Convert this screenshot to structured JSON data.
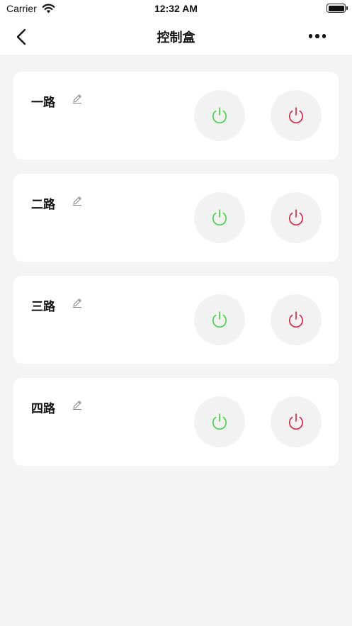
{
  "status_bar": {
    "carrier": "Carrier",
    "time": "12:32 AM"
  },
  "nav": {
    "title": "控制盒",
    "back_icon": "chevron-left-icon",
    "more_icon": "more-horizontal-icon"
  },
  "colors": {
    "on_accent": "#3ad13a",
    "off_accent": "#d8203c",
    "background": "#f4f4f4",
    "card": "#ffffff"
  },
  "channels": [
    {
      "name": "一路",
      "edit_icon": "pencil-icon",
      "on_icon": "power-icon",
      "off_icon": "power-icon"
    },
    {
      "name": "二路",
      "edit_icon": "pencil-icon",
      "on_icon": "power-icon",
      "off_icon": "power-icon"
    },
    {
      "name": "三路",
      "edit_icon": "pencil-icon",
      "on_icon": "power-icon",
      "off_icon": "power-icon"
    },
    {
      "name": "四路",
      "edit_icon": "pencil-icon",
      "on_icon": "power-icon",
      "off_icon": "power-icon"
    }
  ]
}
